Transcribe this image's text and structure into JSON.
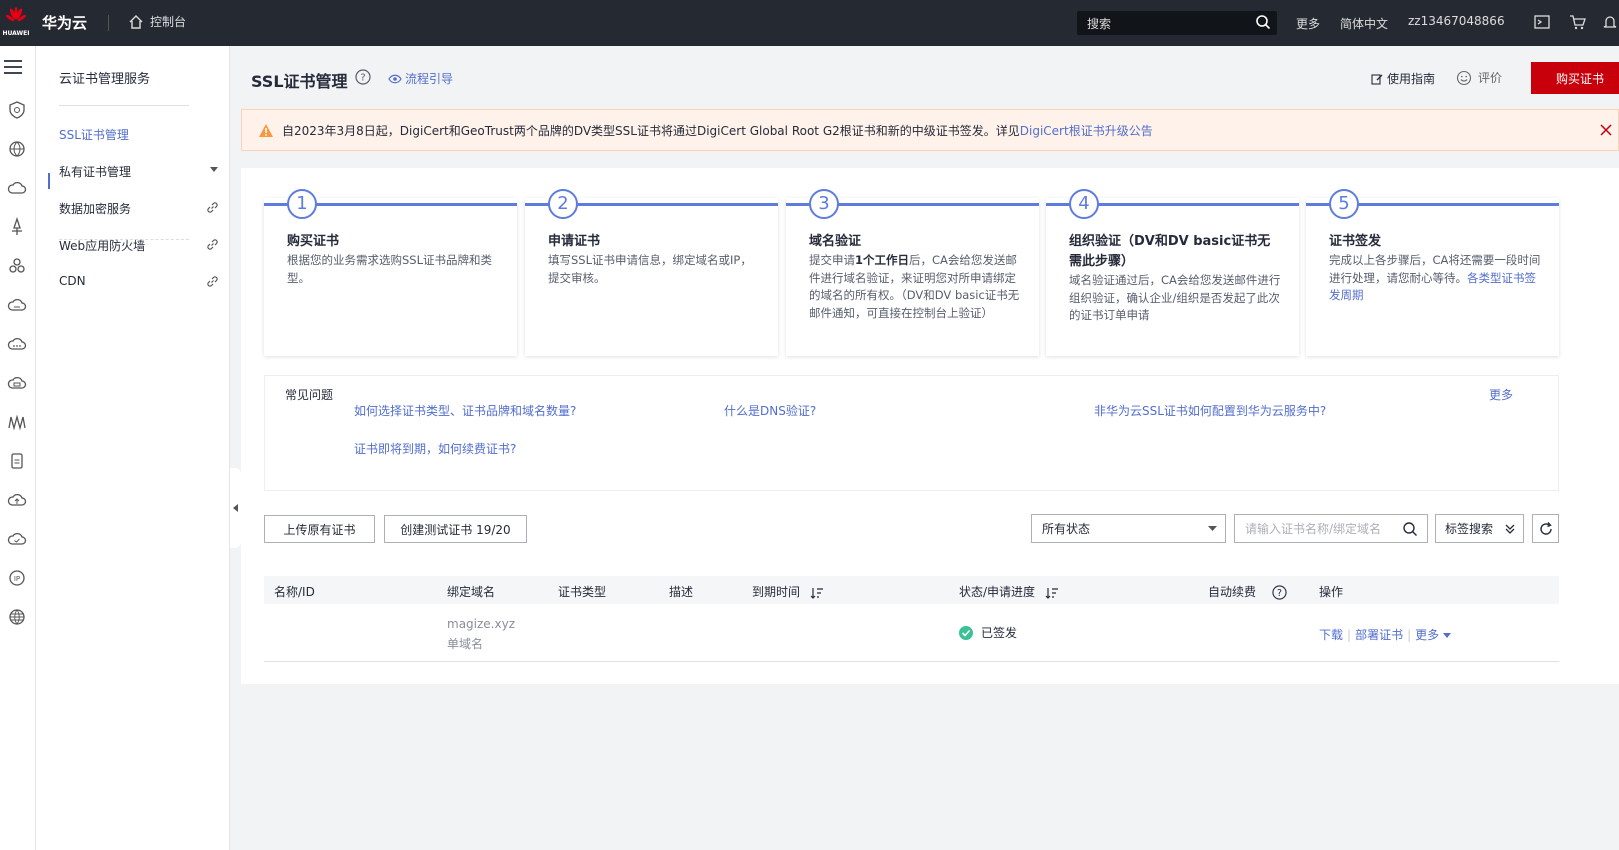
{
  "topbar": {
    "logo_text": "HUAWEI",
    "brand": "华为云",
    "console": "控制台",
    "search_placeholder": "搜索",
    "more": "更多",
    "language": "简体中文",
    "username": "zz13467048866"
  },
  "sidebar": {
    "title": "云证书管理服务",
    "items": [
      {
        "label": "SSL证书管理",
        "active": true
      },
      {
        "label": "私有证书管理",
        "expandable": true
      },
      {
        "label": "数据加密服务",
        "external": true
      },
      {
        "label": "Web应用防火墙",
        "external": true
      },
      {
        "label": "CDN",
        "external": true
      }
    ]
  },
  "header": {
    "title": "SSL证书管理",
    "guide": "流程引导",
    "manual": "使用指南",
    "rate": "评价",
    "buy": "购买证书"
  },
  "notice": {
    "text": "自2023年3月8日起，DigiCert和GeoTrust两个品牌的DV类型SSL证书将通过DigiCert Global Root G2根证书和新的中级证书签发。详见",
    "link": "DigiCert根证书升级公告"
  },
  "steps": [
    {
      "num": "1",
      "title": "购买证书",
      "desc": "根据您的业务需求选购SSL证书品牌和类型。"
    },
    {
      "num": "2",
      "title": "申请证书",
      "desc": "填写SSL证书申请信息，绑定域名或IP，提交审核。"
    },
    {
      "num": "3",
      "title": "域名验证",
      "desc_pre": "提交申请",
      "desc_bold": "1个工作日",
      "desc_post": "后，CA会给您发送邮件进行域名验证，来证明您对所申请绑定的域名的所有权。（DV和DV basic证书无邮件通知，可直接在控制台上验证）"
    },
    {
      "num": "4",
      "title": "组织验证（DV和DV basic证书无需此步骤）",
      "desc": "域名验证通过后，CA会给您发送邮件进行组织验证，确认企业/组织是否发起了此次的证书订单申请"
    },
    {
      "num": "5",
      "title": "证书签发",
      "desc": "完成以上各步骤后，CA将还需要一段时间进行处理，请您耐心等待。",
      "link": "各类型证书签发周期"
    }
  ],
  "faq": {
    "title": "常见问题",
    "more": "更多",
    "questions": [
      "如何选择证书类型、证书品牌和域名数量?",
      "什么是DNS验证?",
      "非华为云SSL证书如何配置到华为云服务中?",
      "证书即将到期，如何续费证书?"
    ]
  },
  "toolbar": {
    "upload": "上传原有证书",
    "create_test": "创建测试证书 19/20",
    "status_filter": "所有状态",
    "search_placeholder": "请输入证书名称/绑定域名",
    "tag_search": "标签搜索"
  },
  "table": {
    "columns": [
      "名称/ID",
      "绑定域名",
      "证书类型",
      "描述",
      "到期时间",
      "状态/申请进度",
      "自动续费",
      "操作"
    ],
    "rows": [
      {
        "domain": "magize.xyz",
        "domain_type": "单域名",
        "status": "已签发",
        "ops": [
          "下载",
          "部署证书",
          "更多"
        ]
      }
    ]
  },
  "colors": {
    "brand_red": "#c7000b",
    "link_blue": "#526ecc",
    "step_blue": "#5e7ce0",
    "success_green": "#3ac295",
    "warning_orange": "#fa9841"
  }
}
